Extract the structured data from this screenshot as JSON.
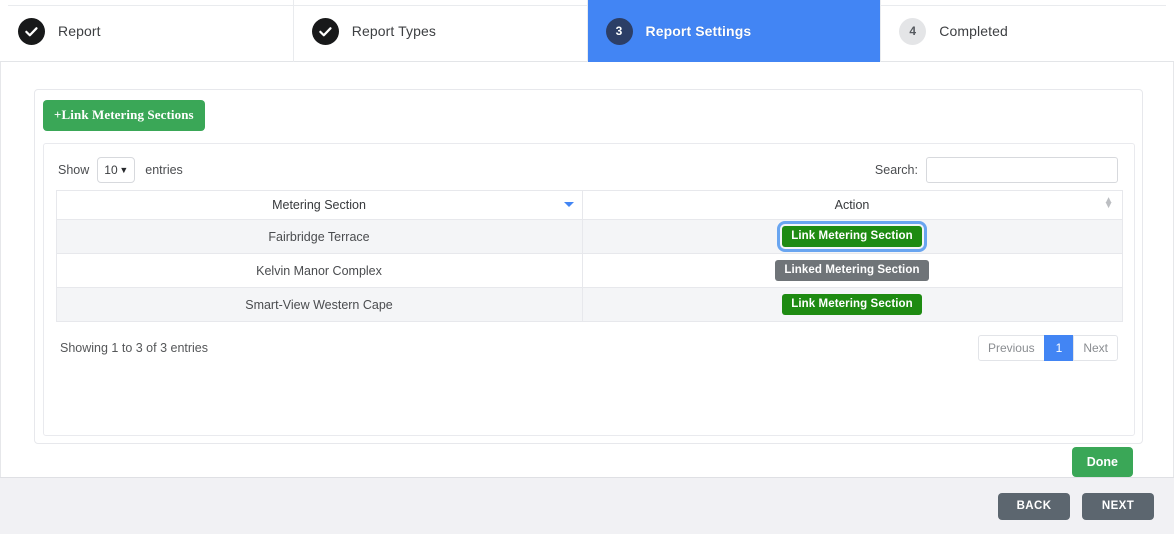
{
  "wizard": {
    "steps": [
      {
        "label": "Report",
        "marker": "check",
        "state": "done"
      },
      {
        "label": "Report Types",
        "marker": "check",
        "state": "done"
      },
      {
        "label": "Report Settings",
        "marker": "3",
        "state": "active"
      },
      {
        "label": "Completed",
        "marker": "4",
        "state": "todo"
      }
    ]
  },
  "toolbar": {
    "link_sections_label": "+Link Metering Sections"
  },
  "datatable": {
    "length_prefix": "Show",
    "length_value": "10",
    "length_suffix": "entries",
    "search_label": "Search:",
    "search_value": "",
    "search_placeholder": "",
    "columns": [
      {
        "label": "Metering Section",
        "sort": "asc"
      },
      {
        "label": "Action",
        "sort": "both"
      }
    ],
    "rows": [
      {
        "name": "Fairbridge Terrace",
        "action_label": "Link Metering Section",
        "action_state": "link",
        "focused": true
      },
      {
        "name": "Kelvin Manor Complex",
        "action_label": "Linked Metering Section",
        "action_state": "linked",
        "focused": false
      },
      {
        "name": "Smart-View Western Cape",
        "action_label": "Link Metering Section",
        "action_state": "link",
        "focused": false
      }
    ],
    "info": "Showing 1 to 3 of 3 entries",
    "pagination": {
      "previous": "Previous",
      "pages": [
        "1"
      ],
      "current_page": "1",
      "next": "Next"
    }
  },
  "actions": {
    "done_label": "Done",
    "back_label": "BACK",
    "next_label": "NEXT"
  },
  "colors": {
    "active_step_blue": "#4285f4",
    "link_button_green": "#1e8b12",
    "toolbar_green": "#3aa757",
    "linked_gray": "#6f7478",
    "nav_gray": "#5c666f",
    "focus_ring_blue": "#69a5f0"
  }
}
